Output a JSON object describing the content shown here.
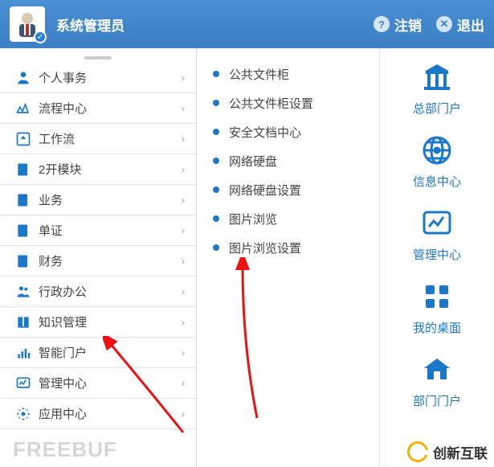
{
  "header": {
    "username": "系统管理员",
    "logout": "注销",
    "exit": "退出"
  },
  "sidebar": [
    {
      "label": "个人事务",
      "icon": "person"
    },
    {
      "label": "流程中心",
      "icon": "flow"
    },
    {
      "label": "工作流",
      "icon": "workflow"
    },
    {
      "label": "2开模块",
      "icon": "module"
    },
    {
      "label": "业务",
      "icon": "biz"
    },
    {
      "label": "单证",
      "icon": "doc"
    },
    {
      "label": "财务",
      "icon": "finance"
    },
    {
      "label": "行政办公",
      "icon": "admin"
    },
    {
      "label": "知识管理",
      "icon": "knowledge"
    },
    {
      "label": "智能门户",
      "icon": "portal"
    },
    {
      "label": "管理中心",
      "icon": "manage"
    },
    {
      "label": "应用中心",
      "icon": "app"
    }
  ],
  "submenu": [
    "公共文件柜",
    "公共文件柜设置",
    "安全文档中心",
    "网络硬盘",
    "网络硬盘设置",
    "图片浏览",
    "图片浏览设置"
  ],
  "portals": [
    {
      "label": "总部门户",
      "icon": "building"
    },
    {
      "label": "信息中心",
      "icon": "globe"
    },
    {
      "label": "管理中心",
      "icon": "chart"
    },
    {
      "label": "我的桌面",
      "icon": "grid"
    },
    {
      "label": "部门门户",
      "icon": "house"
    }
  ],
  "watermark": "FREEBUF",
  "watermark2": "创新互联"
}
